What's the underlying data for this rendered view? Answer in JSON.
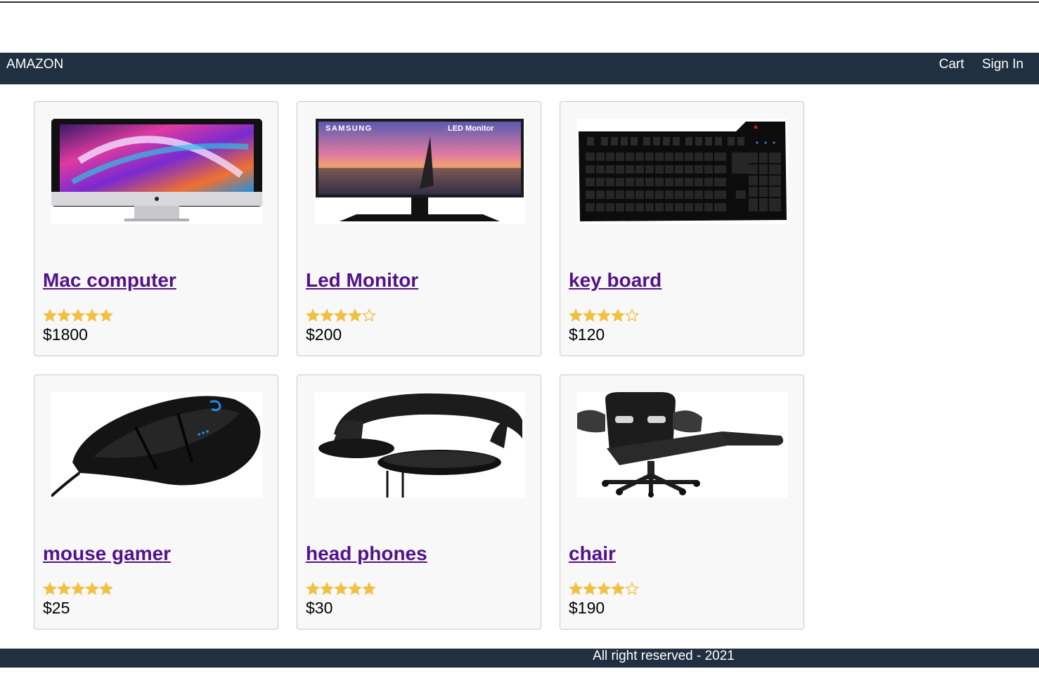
{
  "header": {
    "brand": "AMAZON",
    "nav": {
      "cart": "Cart",
      "signin": "Sign In"
    }
  },
  "products": [
    {
      "name": "Mac computer",
      "price": "$1800",
      "rating": 5,
      "image": "imac-image"
    },
    {
      "name": "Led Monitor",
      "price": "$200",
      "rating": 4,
      "image": "monitor-image"
    },
    {
      "name": "key board",
      "price": "$120",
      "rating": 4,
      "image": "keyboard-image"
    },
    {
      "name": "mouse gamer",
      "price": "$25",
      "rating": 5,
      "image": "mouse-image"
    },
    {
      "name": "head phones",
      "price": "$30",
      "rating": 5,
      "image": "headphones-image"
    },
    {
      "name": "chair",
      "price": "$190",
      "rating": 4,
      "image": "chair-image"
    }
  ],
  "image_text": {
    "monitor_brand": "SAMSUNG",
    "monitor_label": "LED Monitor"
  },
  "footer": {
    "text": "All right reserved - 2021"
  },
  "colors": {
    "header_bg": "#203040",
    "link": "#53128a",
    "star": "#f0c040"
  }
}
